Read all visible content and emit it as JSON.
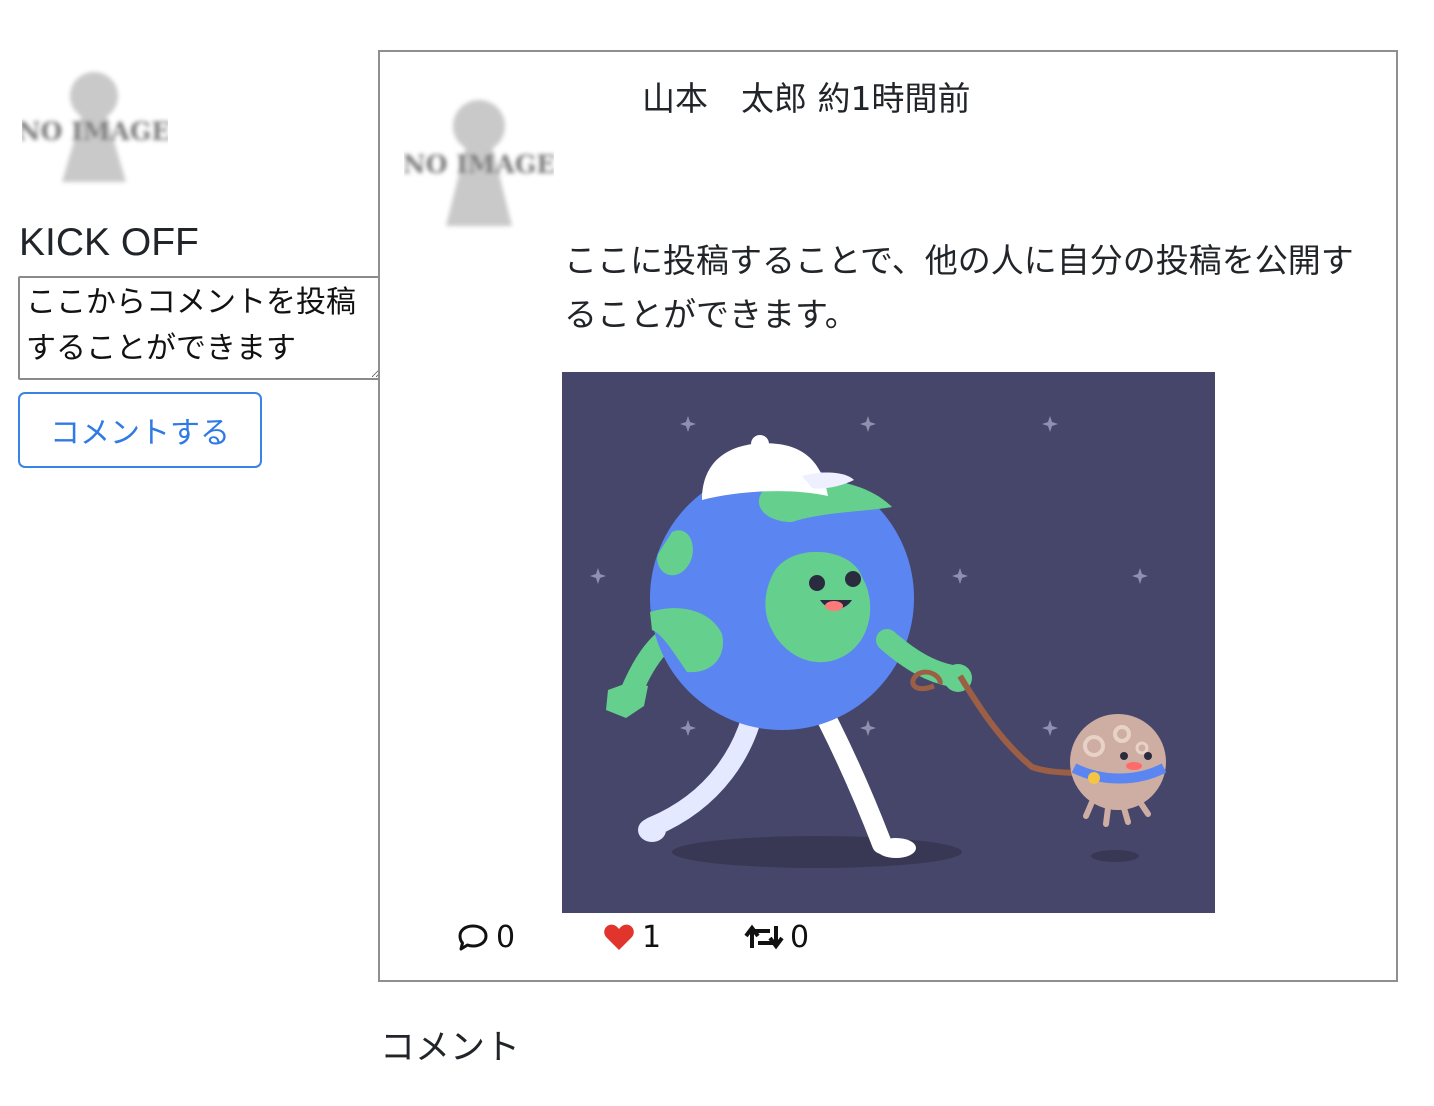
{
  "sidebar": {
    "avatar_alt": "NO IMAGE",
    "username": "KICK OFF",
    "comment_placeholder": "ここからコメントを投稿することができます",
    "comment_button_label": "コメントする"
  },
  "post": {
    "avatar_alt": "NO IMAGE",
    "author": "山本　太郎",
    "time_ago": "約1時間前",
    "body": "ここに投稿することで、他の人に自分の投稿を公開することができます。",
    "image_icon": "earth-walking-moon-illustration",
    "actions": {
      "comment_count": "0",
      "like_count": "1",
      "retweet_count": "0"
    }
  },
  "comments_section": {
    "heading": "コメント"
  },
  "colors": {
    "accent": "#2f7ae5",
    "like": "#e0342c",
    "image_bg": "#46466a"
  },
  "icons": {
    "comment": "speech-bubble-icon",
    "like": "heart-icon",
    "retweet": "retweet-icon",
    "avatar": "no-image-placeholder-icon"
  }
}
